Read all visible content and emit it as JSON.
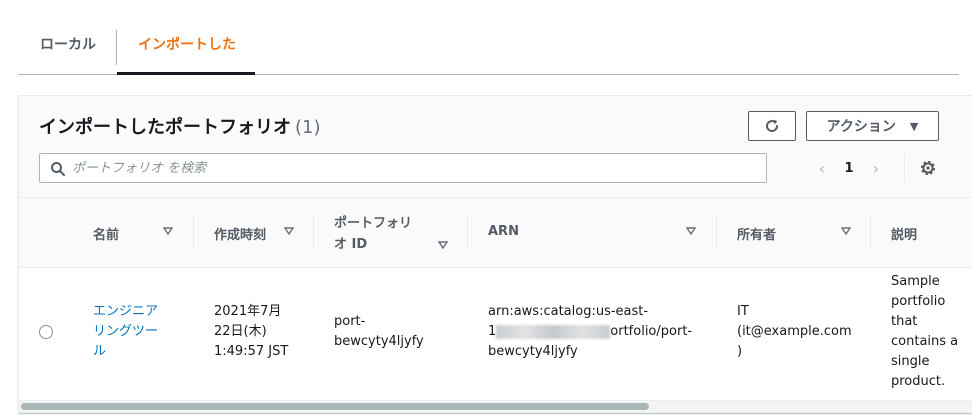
{
  "tabs": {
    "local": "ローカル",
    "imported": "インポートした"
  },
  "panel": {
    "title": "インポートしたポートフォリオ",
    "count": "(1)",
    "actions_label": "アクション",
    "refresh_icon": "refresh-icon",
    "search": {
      "placeholder": "ポートフォリオ を検索",
      "value": ""
    },
    "pagination": {
      "current_page": "1"
    }
  },
  "table": {
    "columns": {
      "name": "名前",
      "created": "作成時刻",
      "portfolio_id": "ポートフォリオ ID",
      "arn": "ARN",
      "owner": "所有者",
      "description": "説明"
    },
    "rows": [
      {
        "name_line1": "エンジニア",
        "name_line2": "リングツー",
        "name_line3": "ル",
        "created_line1": "2021年7月",
        "created_line2": "22日(木)",
        "created_line3": "1:49:57 JST",
        "id_line1": "port-",
        "id_line2": "bewcyty4ljyfy",
        "arn_line1": "arn:aws:catalog:us-east-",
        "arn_line2_start": "1",
        "arn_line2_end": "ortfolio/port-",
        "arn_line3": "bewcyty4ljyfy",
        "owner_line1": "IT",
        "owner_line2": "(it@example.com",
        "owner_line3": ")",
        "desc_line1": "Sample",
        "desc_line2": "portfolio",
        "desc_line3": "that",
        "desc_line4": "contains a",
        "desc_line5": "single",
        "desc_line6": "product."
      }
    ]
  },
  "colors": {
    "active_tab": "#ec7211",
    "link": "#0073bb",
    "text": "#16191f",
    "muted": "#545b64"
  }
}
